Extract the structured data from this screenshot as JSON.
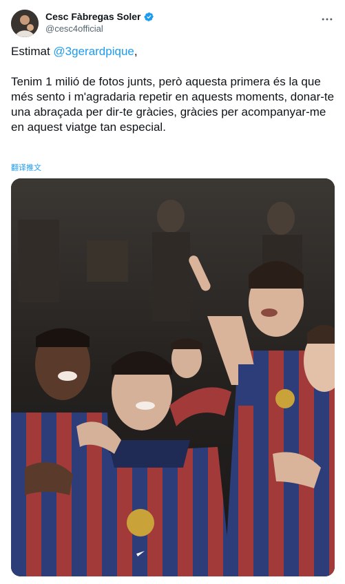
{
  "user": {
    "display_name": "Cesc Fàbregas Soler",
    "handle": "@cesc4official",
    "verified": true,
    "avatar_icon": "avatar-photo"
  },
  "tweet": {
    "greeting_prefix": "Estimat ",
    "mention": "@3gerardpique",
    "greeting_suffix": ",",
    "body": "Tenim 1 milió de fotos junts, però aquesta primera és la que més sento i m'agradaria repetir en aquests moments, donar-te una abraçada per dir-te gràcies, gràcies per acompanyar-me en aquest viatge tan especial.",
    "translate_label": "翻译推文"
  },
  "colors": {
    "accent": "#1d9bf0",
    "text": "#0f1419",
    "secondary": "#536471"
  },
  "icons": [
    "verified-badge-icon",
    "more-options-icon"
  ]
}
